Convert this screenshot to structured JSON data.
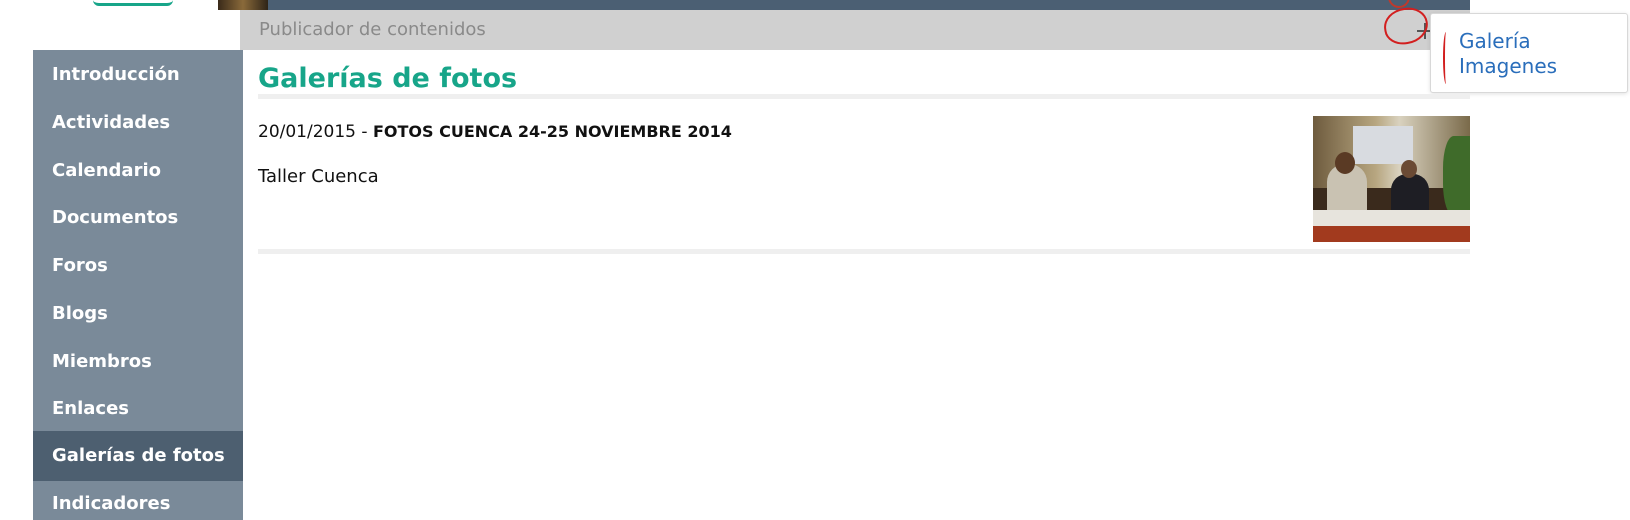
{
  "portlet": {
    "title": "Publicador de contenidos",
    "add_icon": "plus-icon",
    "add_menu": {
      "items": [
        "Galería",
        "Imagenes"
      ]
    }
  },
  "sidebar": {
    "items": [
      {
        "label": "Introducción",
        "active": false
      },
      {
        "label": "Actividades",
        "active": false
      },
      {
        "label": "Calendario",
        "active": false
      },
      {
        "label": "Documentos",
        "active": false
      },
      {
        "label": "Foros",
        "active": false
      },
      {
        "label": "Blogs",
        "active": false
      },
      {
        "label": "Miembros",
        "active": false
      },
      {
        "label": "Enlaces",
        "active": false
      },
      {
        "label": "Galerías de fotos",
        "active": true
      },
      {
        "label": "Indicadores",
        "active": false
      }
    ]
  },
  "main": {
    "page_title": "Galerías de fotos",
    "entries": [
      {
        "date": "20/01/2015",
        "separator": " - ",
        "title": "FOTOS CUENCA 24-25 NOVIEMBRE 2014",
        "description": "Taller Cuenca",
        "thumbnail": "conference-photo"
      }
    ]
  },
  "colors": {
    "accent": "#17a589",
    "sidebar_bg": "#7a8a99",
    "sidebar_active": "#4d5f70",
    "link": "#2a6ebb",
    "annotation": "#d21f1f"
  }
}
